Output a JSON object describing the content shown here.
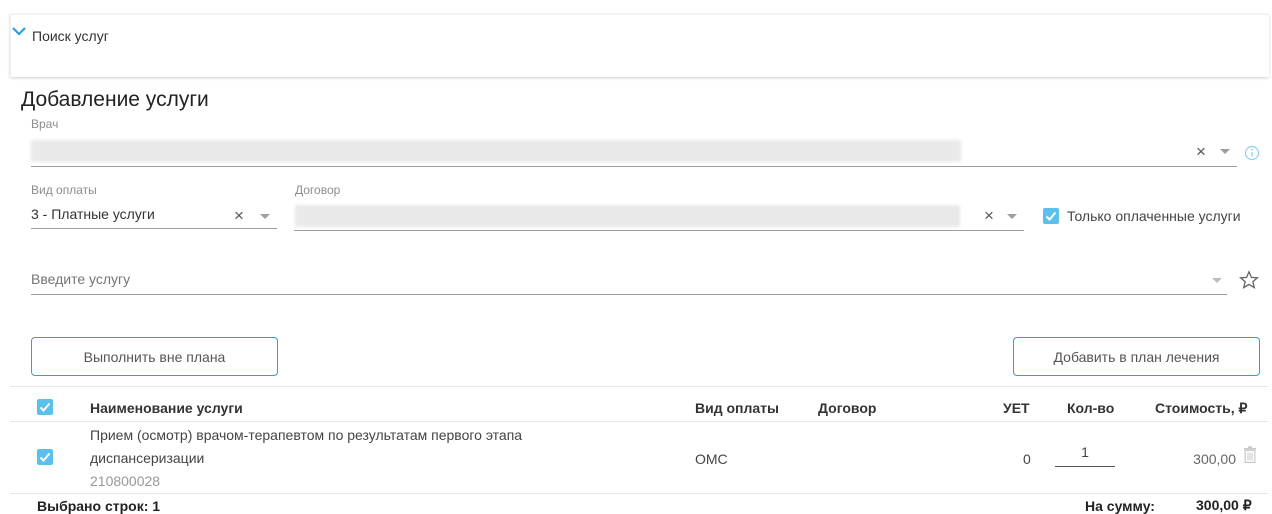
{
  "search_panel": {
    "title": "Поиск услуг",
    "icon": "chevron-down-icon"
  },
  "section": {
    "title": "Добавление услуги"
  },
  "doctor": {
    "label": "Врач",
    "value": ""
  },
  "payment": {
    "label": "Вид оплаты",
    "value": "3 - Платные услуги"
  },
  "contract": {
    "label": "Договор",
    "value": ""
  },
  "only_paid": {
    "label": "Только оплаченные услуги",
    "checked": true
  },
  "service_input": {
    "placeholder": "Введите услугу"
  },
  "buttons": {
    "execute_outside_plan": "Выполнить вне плана",
    "add_to_plan": "Добавить в план лечения"
  },
  "table": {
    "headers": {
      "name": "Наименование услуги",
      "payment": "Вид оплаты",
      "contract": "Договор",
      "uet": "УЕТ",
      "qty": "Кол-во",
      "cost": "Стоимость, ₽"
    },
    "rows": [
      {
        "name_line1": "Прием (осмотр) врачом-терапевтом по результатам первого этапа",
        "name_line2": "диспансеризации",
        "code": "210800028",
        "payment": "ОМС",
        "contract": "",
        "uet": "0",
        "qty": "1",
        "cost": "300,00",
        "checked": true
      }
    ]
  },
  "footer": {
    "selected": "Выбрано строк: 1",
    "sum_label": "На сумму:",
    "sum_value": "300,00 ₽"
  },
  "colors": {
    "accent": "#2e9fd8",
    "checkbox": "#5bc0eb"
  }
}
